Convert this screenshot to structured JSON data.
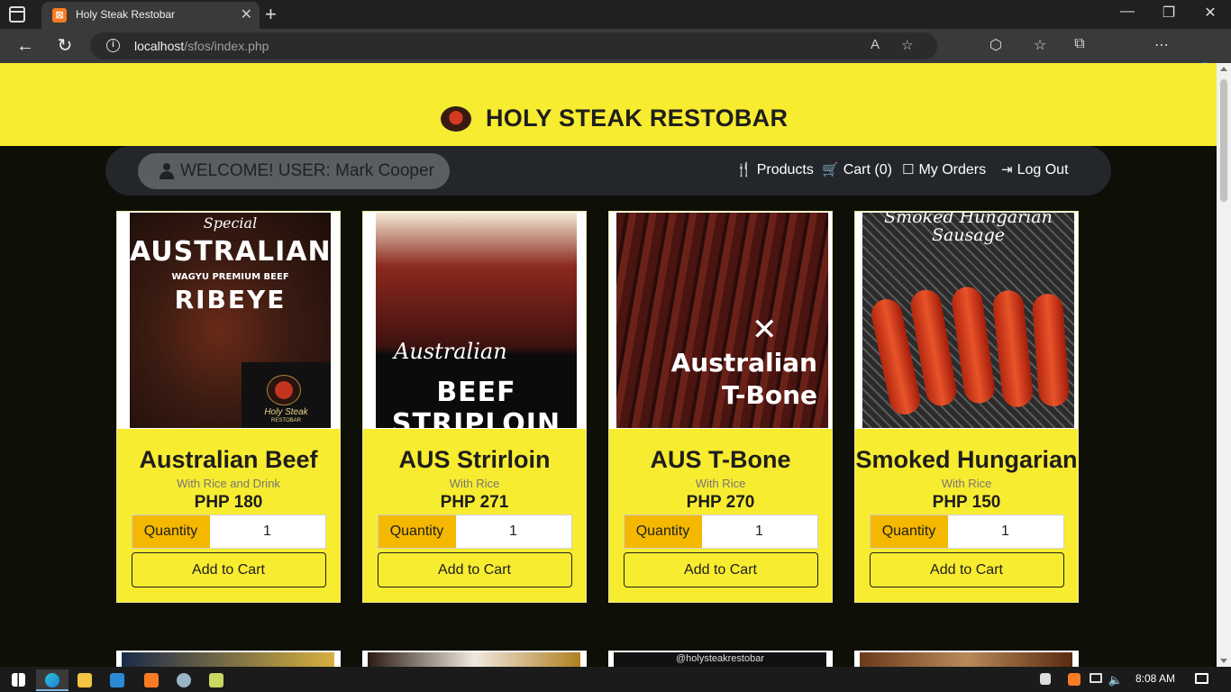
{
  "browser": {
    "tab_title": "Holy Steak Restobar",
    "url_host": "localhost",
    "url_path": "/sfos/index.php"
  },
  "site": {
    "brand": "HOLY STEAK RESTOBAR",
    "welcome": "WELCOME! USER: Mark Cooper",
    "nav": {
      "products": "Products",
      "cart": "Cart (0)",
      "orders": "My Orders",
      "logout": "Log Out"
    }
  },
  "products": [
    {
      "name": "Australian Beef",
      "desc": "With Rice and Drink",
      "price": "PHP 180",
      "quantity_label": "Quantity",
      "quantity": "1",
      "button": "Add to Cart",
      "image_text": [
        "Special",
        "AUSTRALIAN",
        "WAGYU PREMIUM BEEF",
        "RIBEYE",
        "Holy Steak",
        "RESTOBAR"
      ]
    },
    {
      "name": "AUS Strirloin",
      "desc": "With Rice",
      "price": "PHP 271",
      "quantity_label": "Quantity",
      "quantity": "1",
      "button": "Add to Cart",
      "image_text": [
        "Australian",
        "BEEF STRIPLOIN"
      ]
    },
    {
      "name": "AUS T-Bone",
      "desc": "With Rice",
      "price": "PHP 270",
      "quantity_label": "Quantity",
      "quantity": "1",
      "button": "Add to Cart",
      "image_text": [
        "Australian",
        "T-Bone"
      ]
    },
    {
      "name": "Smoked Hungarian",
      "desc": "With Rice",
      "price": "PHP 150",
      "quantity_label": "Quantity",
      "quantity": "1",
      "button": "Add to Cart",
      "image_text": [
        "Smoked Hungarian",
        "Sausage"
      ]
    }
  ],
  "peek_image_text": "@holysteakrestobar",
  "taskbar": {
    "time": "8:08 AM"
  },
  "colors": {
    "header_yellow": "#f8ec30",
    "page_background": "#0e0f06",
    "navbar": "#23262b",
    "quantity_label": "#f5b800"
  }
}
